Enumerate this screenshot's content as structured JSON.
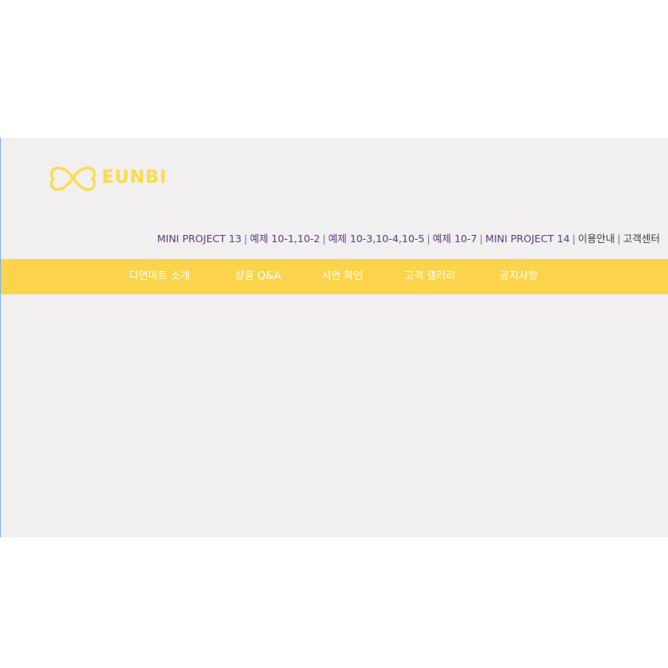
{
  "logo": {
    "text": "EUNBI",
    "icon": "infinity-heart-logo-icon",
    "color": "#f8dc4c"
  },
  "top_links": [
    {
      "label": "MINI PROJECT 13"
    },
    {
      "label": "예제 10-1,10-2"
    },
    {
      "label": "예제 10-3,10-4,10-5"
    },
    {
      "label": "예제 10-7"
    },
    {
      "label": "MINI PROJECT 14"
    },
    {
      "label": "이용안내"
    },
    {
      "label": "고객센터"
    }
  ],
  "separator": "|",
  "nav": {
    "background": "#fcd44b",
    "items": [
      {
        "label": "다연마트 소개"
      },
      {
        "label": "상품 Q&A"
      },
      {
        "label": "시안 확인"
      },
      {
        "label": "고객 갤러리"
      },
      {
        "label": "공지사항"
      }
    ]
  },
  "colors": {
    "link": "#5a3a86",
    "page_background": "#f1eff0",
    "nav_text": "#ffffff"
  }
}
